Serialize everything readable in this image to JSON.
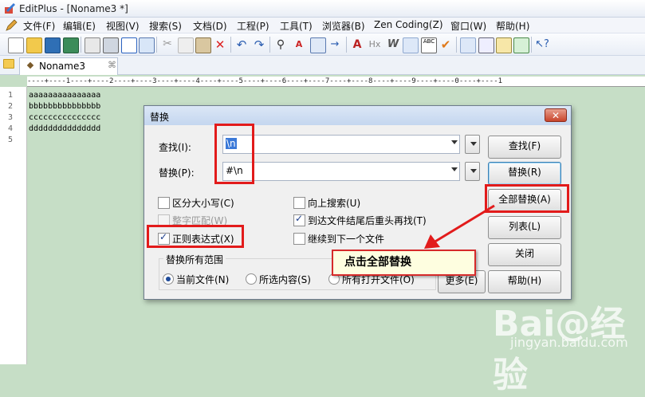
{
  "window": {
    "title": "EditPlus - [Noname3 *]"
  },
  "menu": [
    "文件(F)",
    "编辑(E)",
    "视图(V)",
    "搜索(S)",
    "文档(D)",
    "工程(P)",
    "工具(T)",
    "浏览器(B)",
    "Zen Coding(Z)",
    "窗口(W)",
    "帮助(H)"
  ],
  "toolbar_icons": [
    "new-file-icon",
    "open-folder-icon",
    "save-icon",
    "save-all-icon",
    "print-preview-icon",
    "print-icon",
    "spellcheck-icon",
    "refresh-icon",
    "cut-icon",
    "copy-icon",
    "paste-icon",
    "delete-icon",
    "undo-icon",
    "redo-icon",
    "find-icon",
    "replace-icon",
    "find-in-files-icon",
    "goto-icon",
    "font-icon",
    "hex-icon",
    "word-wrap-icon",
    "indent-icon",
    "abc-icon",
    "check-icon",
    "view-icon",
    "browser-icon",
    "screen-icon",
    "window-icon",
    "help-icon"
  ],
  "tab": {
    "label": "Noname3",
    "close": "⌘"
  },
  "ruler": "----+----1----+----2----+----3----+----4----+----5----+----6----+----7----+----8----+----9----+----0----+----1",
  "editor": {
    "line_numbers": [
      "1",
      "2",
      "3",
      "4",
      "5"
    ],
    "lines": [
      "aaaaaaaaaaaaaaa",
      "bbbbbbbbbbbbbbb",
      "ccccccccccccccc",
      "ddddddddddddddd",
      ""
    ]
  },
  "dialog": {
    "title": "替换",
    "close": "✕",
    "find_label": "查找(I):",
    "find_value": "\\n",
    "replace_label": "替换(P):",
    "replace_value": "#\\n",
    "options": {
      "match_case": {
        "label": "区分大小写(C)",
        "checked": false
      },
      "whole_word": {
        "label": "整字匹配(W)",
        "checked": false
      },
      "regex": {
        "label": "正则表达式(X)",
        "checked": true
      },
      "search_up": {
        "label": "向上搜索(U)",
        "checked": false
      },
      "wrap_around": {
        "label": "到达文件结尾后重头再找(T)",
        "checked": true
      },
      "continue_next": {
        "label": "继续到下一个文件",
        "checked": false
      }
    },
    "scope": {
      "legend": "替换所有范围",
      "current_file": "当前文件(N)",
      "selection": "所选内容(S)",
      "all_open": "所有打开文件(O)",
      "selected": "current_file"
    },
    "buttons": {
      "find": "查找(F)",
      "replace": "替换(R)",
      "replace_all": "全部替换(A)",
      "list": "列表(L)",
      "close": "关闭",
      "more": "更多(E)",
      "help": "帮助(H)"
    }
  },
  "annotation": {
    "callout": "点击全部替换",
    "color": "#e21b1b"
  },
  "watermark": {
    "brand": "Bai@经验",
    "url": "jingyan.baidu.com"
  }
}
